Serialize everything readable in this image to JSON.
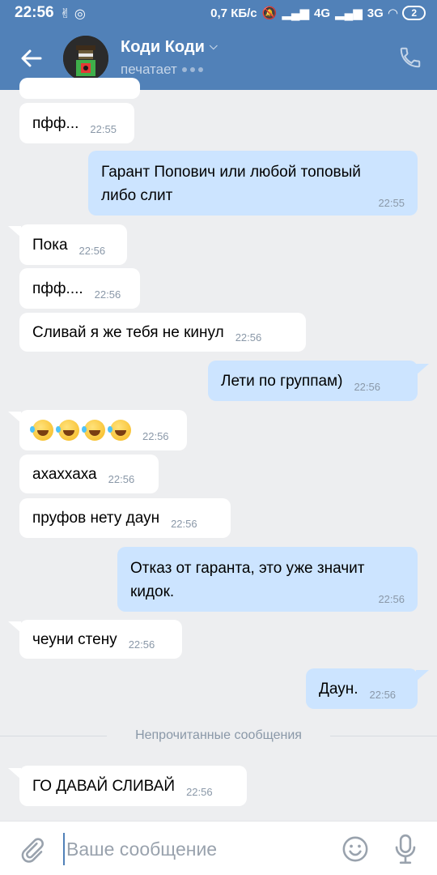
{
  "status_bar": {
    "time": "22:56",
    "speed": "0,7 КБ/с",
    "net1": "4G",
    "net2": "3G",
    "battery": "2"
  },
  "header": {
    "name": "Коди Коди",
    "status": "печатает"
  },
  "messages": [
    {
      "id": "m0",
      "dir": "in",
      "text": "пфф...",
      "time": "22:55"
    },
    {
      "id": "m1",
      "dir": "out",
      "text": "Гарант Попович или любой топовый\nлибо слит",
      "time": "22:55"
    },
    {
      "id": "m2",
      "dir": "in",
      "text": "Пока",
      "time": "22:56"
    },
    {
      "id": "m3",
      "dir": "in",
      "text": "пфф....",
      "time": "22:56"
    },
    {
      "id": "m4",
      "dir": "in",
      "text": "Сливай я же тебя не кинул",
      "time": "22:56"
    },
    {
      "id": "m5",
      "dir": "out",
      "text": "Лети по группам)",
      "time": "22:56"
    },
    {
      "id": "m6",
      "dir": "in",
      "emoji": "rolling-on-floor-laughing x4",
      "time": "22:56"
    },
    {
      "id": "m7",
      "dir": "in",
      "text": "ахаххаха",
      "time": "22:56"
    },
    {
      "id": "m8",
      "dir": "in",
      "text": "пруфов нету даун",
      "time": "22:56"
    },
    {
      "id": "m9",
      "dir": "out",
      "text": "Отказ от гаранта, это уже значит\nкидок.",
      "time": "22:56"
    },
    {
      "id": "m10",
      "dir": "in",
      "text": "чеуни стену",
      "time": "22:56"
    },
    {
      "id": "m11",
      "dir": "out",
      "text": "Даун.",
      "time": "22:56"
    },
    {
      "id": "m12",
      "dir": "in",
      "text": "ГО ДАВАЙ СЛИВАЙ",
      "time": "22:56"
    }
  ],
  "divider": {
    "label": "Непрочитанные сообщения"
  },
  "composer": {
    "placeholder": "Ваше сообщение"
  },
  "colors": {
    "header": "#5181b8",
    "incoming": "#ffffff",
    "outgoing": "#cce4ff",
    "background": "#edeef0"
  },
  "icons": [
    "back-arrow-icon",
    "chevron-down-icon",
    "phone-icon",
    "paperclip-icon",
    "smile-icon",
    "microphone-icon"
  ]
}
